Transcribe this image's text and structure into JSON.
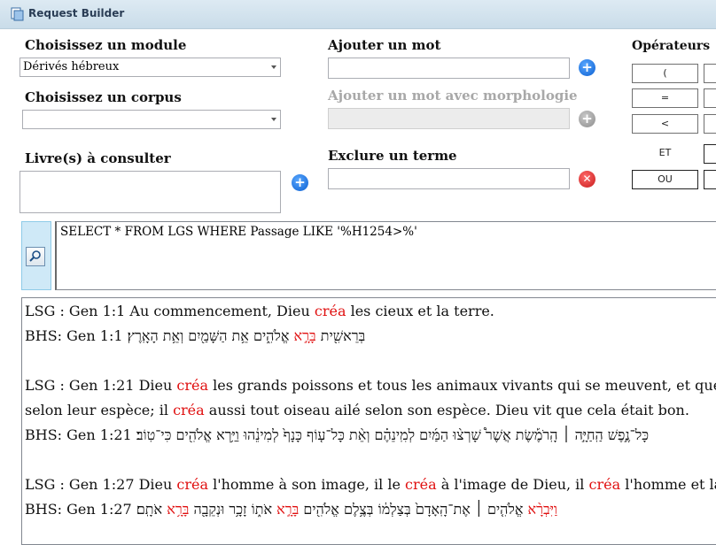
{
  "window": {
    "title": "Request Builder",
    "icon": "app-window-icon"
  },
  "module": {
    "label": "Choisissez un module",
    "value": "Dérivés hébreux"
  },
  "corpus": {
    "label": "Choisissez un corpus",
    "value": ""
  },
  "books": {
    "label": "Livre(s) à consulter"
  },
  "add_word": {
    "label": "Ajouter un mot",
    "value": ""
  },
  "add_word_morph": {
    "label": "Ajouter un mot avec morphologie",
    "value": ""
  },
  "exclude_term": {
    "label": "Exclure un terme",
    "value": ""
  },
  "operators": {
    "label": "Opérateurs",
    "paren_open": "(",
    "equals": "=",
    "less_than": "<",
    "and": "ET",
    "or": "OU"
  },
  "icons": {
    "add": "plus-circle-icon",
    "remove": "x-circle-icon",
    "search": "magnifier-icon"
  },
  "colors": {
    "highlight": "#e01010",
    "add_button": "#0b5fd1",
    "remove_button": "#c71b1b"
  },
  "query": {
    "text": "SELECT * FROM LGS WHERE Passage LIKE '%H1254>%'"
  },
  "results": [
    {
      "lsg_ref": "LSG : Gen 1:1",
      "lsg_a": " Au commencement, Dieu ",
      "lsg_hl1": "créa",
      "lsg_b": " les cieux et la terre.",
      "bhs_ref": "BHS: Gen 1:1",
      "bhs_a": " בְּרֵאשִׁ֖ית ",
      "bhs_hl": "בָּרָ֣א",
      "bhs_b": " אֱלֹהִ֑ים אֵ֥ת הַשָּׁמַ֖יִם וְאֵ֥ת הָאָֽרֶץ׃"
    },
    {
      "lsg_ref": "LSG : Gen 1:21",
      "lsg_a": " Dieu ",
      "lsg_hl1": "créa",
      "lsg_b": " les grands poissons et tous les animaux vivants qui se meuvent, et que les",
      "lsg2_a": "selon leur espèce; il ",
      "lsg2_hl": "créa",
      "lsg2_b": " aussi tout oiseau ailé selon son espèce. Dieu vit que cela était bon.",
      "bhs_ref": "BHS: Gen 1:21",
      "bhs_a": " כָּל־נֶ֣פֶשׁ הַֽחַיָּ֣ה ׀ הָֽרֹמֶ֡שֶׂת אֲשֶׁר֩ שָׁרְצ֨וּ הַמַּ֜יִם לְמִֽינֵהֶ֗ם וְאֵ֨ת כָּל־ע֤וֹף כָּנָף֙ לְמִינֵ֔הוּ וַיַּ֥רְא אֱלֹהִ֖ים כִּי־טֽוֹב׃"
    },
    {
      "lsg_ref": "LSG : Gen 1:27",
      "lsg_a": " Dieu ",
      "lsg_hl1": "créa",
      "lsg_b": " l'homme à son image, il le ",
      "lsg_hl2": "créa",
      "lsg_c": " à l'image de Dieu, il ",
      "lsg_hl3": "créa",
      "lsg_d": " l'homme et la fer",
      "bhs_ref": "BHS: Gen 1:27",
      "bhs_hl": "וַיִּבְרָ֨א",
      "bhs_a": " אֱלֹהִ֤ים ׀ אֶת־הָֽאָדָם֙ בְּצַלְמ֔וֹ בְּצֶ֥לֶם אֱלֹהִ֖ים ",
      "bhs_hl2": "בָּרָ֣א",
      "bhs_b": " אֹת֑וֹ זָכָ֥ר וּנְקֵבָ֖ה ",
      "bhs_hl3": "בָּרָ֥א",
      "bhs_c": " אֹתָֽם׃"
    }
  ]
}
